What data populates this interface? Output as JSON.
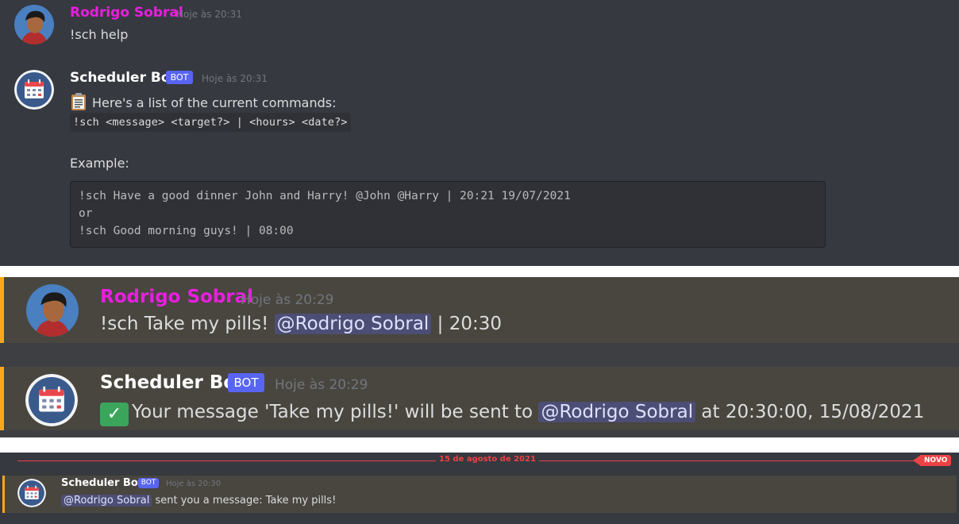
{
  "panel1": {
    "user_msg": {
      "author": "Rodrigo Sobral",
      "timestamp": "Hoje às 20:31",
      "text": "!sch help"
    },
    "bot_msg": {
      "author": "Scheduler Bot",
      "badge": "BOT",
      "timestamp": "Hoje às 20:31",
      "line1": "Here's a list of the current commands:",
      "syntax": "!sch <message> <target?> | <hours> <date?>",
      "example_label": "Example:",
      "code_lines": [
        "!sch Have a good dinner John and Harry! @John @Harry | 20:21 19/07/2021",
        "or",
        "!sch Good morning guys! | 08:00"
      ]
    }
  },
  "panel2": {
    "user_msg": {
      "author": "Rodrigo Sobral",
      "timestamp": "Hoje às 20:29",
      "text_before": "!sch Take my pills! ",
      "mention": "@Rodrigo Sobral",
      "text_after": " | 20:30"
    },
    "bot_msg": {
      "author": "Scheduler Bot",
      "badge": "BOT",
      "timestamp": "Hoje às 20:29",
      "check_icon": "✓",
      "text_before": "Your message 'Take my pills!' will be sent to ",
      "mention": "@Rodrigo Sobral",
      "text_after": " at 20:30:00, 15/08/2021"
    }
  },
  "panel3": {
    "divider_date": "15 de agosto de 2021",
    "new_badge": "NOVO",
    "bot_msg": {
      "author": "Scheduler Bot",
      "badge": "BOT",
      "timestamp": "Hoje às 20:30",
      "mention": "@Rodrigo Sobral",
      "text_after": " sent you a message: Take my pills!"
    }
  },
  "colors": {
    "user_name": "#e91ee0",
    "bot_name": "#ffffff",
    "badge": "#5865f2",
    "highlight_bar": "#faa81a",
    "new_divider": "#ed4245"
  }
}
